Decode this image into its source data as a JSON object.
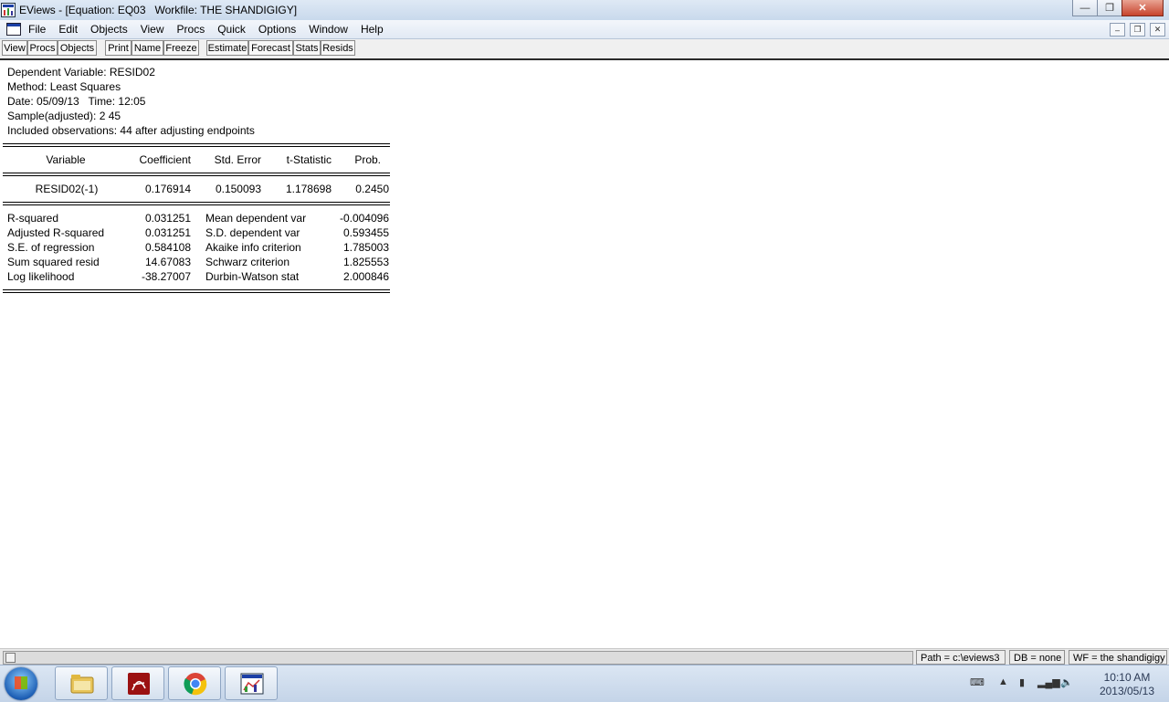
{
  "window": {
    "title": "EViews - [Equation: EQ03   Workfile: THE SHANDIGIGY]"
  },
  "menu": [
    "File",
    "Edit",
    "Objects",
    "View",
    "Procs",
    "Quick",
    "Options",
    "Window",
    "Help"
  ],
  "toolbar": [
    "View",
    "Procs",
    "Objects",
    "Print",
    "Name",
    "Freeze",
    "Estimate",
    "Forecast",
    "Stats",
    "Resids"
  ],
  "output": {
    "header": [
      "Dependent Variable: RESID02",
      "Method: Least Squares",
      "Date: 05/09/13   Time: 12:05",
      "Sample(adjusted): 2 45",
      "Included observations: 44 after adjusting endpoints"
    ],
    "columns": [
      "Variable",
      "Coefficient",
      "Std. Error",
      "t-Statistic",
      "Prob."
    ],
    "coef_row": [
      "RESID02(-1)",
      "0.176914",
      "0.150093",
      "1.178698",
      "0.2450"
    ],
    "stats": [
      [
        "R-squared",
        "0.031251",
        "Mean dependent var",
        "-0.004096"
      ],
      [
        "Adjusted R-squared",
        "0.031251",
        "S.D. dependent var",
        "0.593455"
      ],
      [
        "S.E. of regression",
        "0.584108",
        "Akaike info criterion",
        "1.785003"
      ],
      [
        "Sum squared resid",
        "14.67083",
        "Schwarz criterion",
        "1.825553"
      ],
      [
        "Log likelihood",
        "-38.27007",
        "Durbin-Watson stat",
        "2.000846"
      ]
    ]
  },
  "status": {
    "path": "Path = c:\\eviews3",
    "db": "DB = none",
    "wf": "WF = the shandigigy"
  },
  "taskbar": {
    "apps": [
      "explorer-icon",
      "acrobat-icon",
      "chrome-icon",
      "eviews-icon"
    ],
    "time": "10:10 AM",
    "date": "2013/05/13"
  }
}
